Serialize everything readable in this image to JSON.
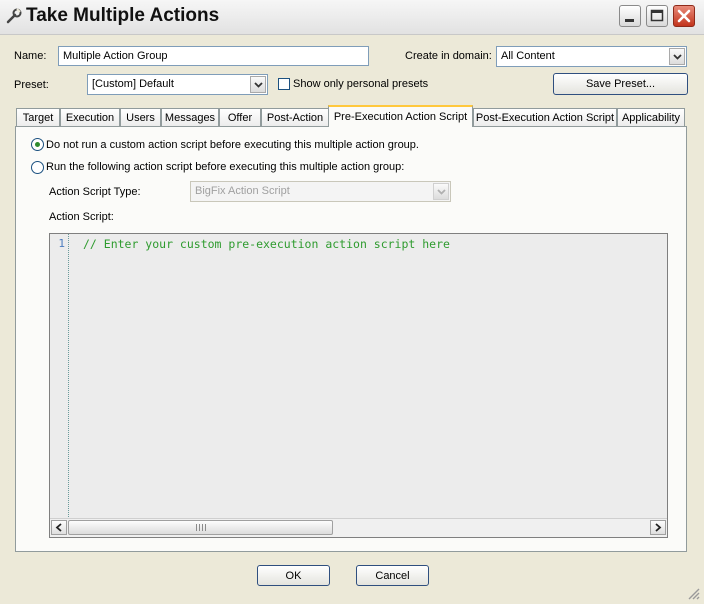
{
  "window": {
    "title": "Take Multiple Actions"
  },
  "form": {
    "name_label": "Name:",
    "name_value": "Multiple Action Group",
    "domain_label": "Create in domain:",
    "domain_value": "All Content",
    "preset_label": "Preset:",
    "preset_value": "[Custom] Default",
    "show_personal_label": "Show only personal presets",
    "show_personal_checked": false,
    "save_preset_label": "Save Preset..."
  },
  "tabs": [
    {
      "label": "Target"
    },
    {
      "label": "Execution"
    },
    {
      "label": "Users"
    },
    {
      "label": "Messages"
    },
    {
      "label": "Offer"
    },
    {
      "label": "Post-Action"
    },
    {
      "label": "Pre-Execution Action Script",
      "active": true
    },
    {
      "label": "Post-Execution Action Script"
    },
    {
      "label": "Applicability"
    }
  ],
  "pre_execution": {
    "option_none_label": "Do not run a custom action script before executing this multiple action group.",
    "option_run_label": "Run the following action script before executing this multiple action group:",
    "selected_option": "none",
    "script_type_label": "Action Script Type:",
    "script_type_value": "BigFix Action Script",
    "script_label": "Action Script:",
    "editor": {
      "line_numbers": [
        "1"
      ],
      "code": "// Enter your custom pre-execution action script here"
    }
  },
  "footer": {
    "ok_label": "OK",
    "cancel_label": "Cancel"
  },
  "icons": [
    "wrench-icon",
    "minimize-icon",
    "maximize-icon",
    "close-icon",
    "chevron-down-icon",
    "scroll-left-icon",
    "scroll-right-icon",
    "resize-grip-icon"
  ],
  "colors": {
    "code_comment": "#2e9b2e",
    "active_tab_accent": "#ffc83c",
    "close_button": "#c2341c"
  }
}
